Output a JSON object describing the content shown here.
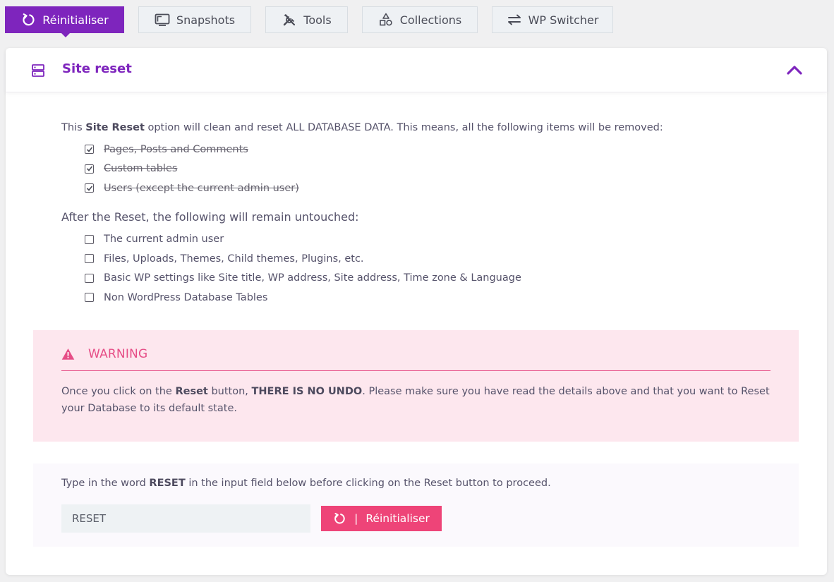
{
  "tabs": [
    {
      "label": "Réinitialiser",
      "icon": "reset-icon",
      "active": true
    },
    {
      "label": "Snapshots",
      "icon": "monitor-icon",
      "active": false
    },
    {
      "label": "Tools",
      "icon": "tools-icon",
      "active": false
    },
    {
      "label": "Collections",
      "icon": "shapes-icon",
      "active": false
    },
    {
      "label": "WP Switcher",
      "icon": "swap-icon",
      "active": false
    }
  ],
  "panel": {
    "title": "Site reset",
    "intro": {
      "before": "This ",
      "bold": "Site Reset",
      "after": " option will clean and reset ALL DATABASE DATA. This means, all the following items will be removed:"
    },
    "removed_items": [
      "Pages, Posts and Comments",
      "Custom tables",
      "Users (except the current admin user)"
    ],
    "kept_heading": "After the Reset, the following will remain untouched:",
    "kept_items": [
      "The current admin user",
      "Files, Uploads, Themes, Child themes, Plugins, etc.",
      "Basic WP settings like Site title, WP address, Site address, Time zone & Language",
      "Non WordPress Database Tables"
    ]
  },
  "warning": {
    "title": "WARNING",
    "text_1": "Once you click on the ",
    "bold_1": "Reset",
    "text_2": " button, ",
    "bold_2": "THERE IS NO UNDO",
    "text_3": ". Please make sure you have read the details above and that you want to Reset your Database to its default state."
  },
  "confirm": {
    "text_1": "Type in the word ",
    "bold": "RESET",
    "text_2": " in the input field below before clicking on the Reset button to proceed.",
    "input_value": "RESET",
    "button_sep": "|",
    "button_label": "Réinitialiser"
  },
  "colors": {
    "accent": "#7e25bd",
    "warning": "#e64d86",
    "warning_bg": "#fde7ee",
    "button": "#ee4478"
  }
}
